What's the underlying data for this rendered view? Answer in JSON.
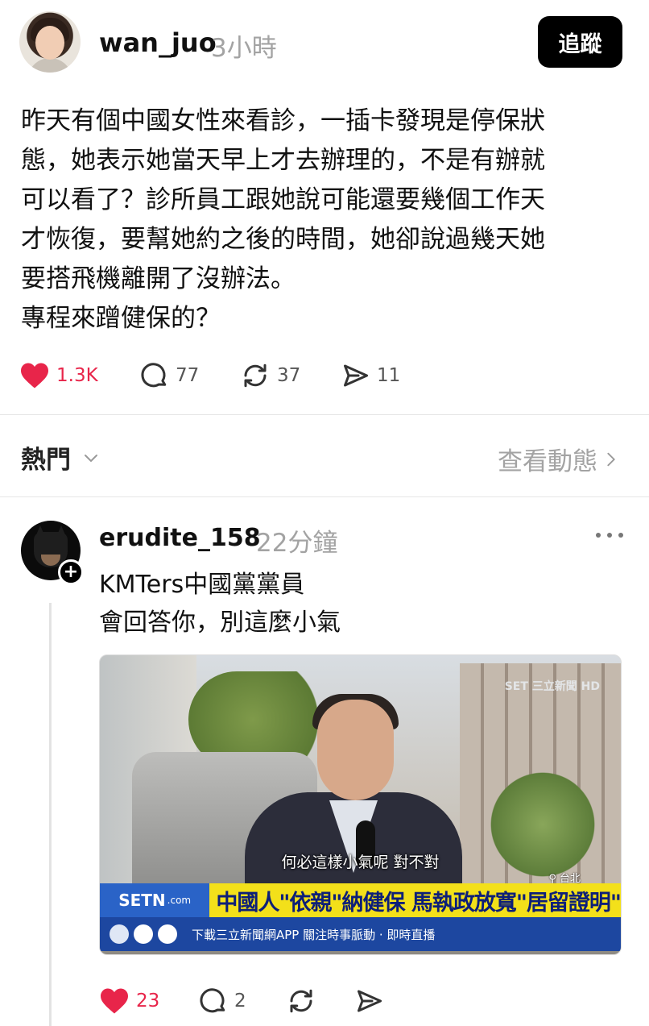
{
  "post": {
    "username": "wan_juo",
    "time": "3小時",
    "follow_label": "追蹤",
    "lines": [
      "昨天有個中國女性來看診，一插卡發現是停保狀",
      "態，她表示她當天早上才去辦理的，不是有辦就",
      "可以看了？診所員工跟她說可能還要幾個工作天",
      "才恢復，要幫她約之後的時間，她卻說過幾天她",
      "要搭飛機離開了沒辦法。",
      "專程來蹭健保的？"
    ],
    "likes": "1.3K",
    "comments": "77",
    "reposts": "37",
    "shares": "11"
  },
  "sort": {
    "label": "熱門",
    "view_activity": "查看動態"
  },
  "reply": {
    "username": "erudite_158",
    "time": "22分鐘",
    "lines": [
      "KMTers中國黨黨員",
      "會回答你，別這麼小氣"
    ],
    "image": {
      "subtitle": "何必這樣小氣呢 對不對",
      "location": "台北",
      "brand": "SETN",
      "brand_suffix": ".com",
      "headline": "中國人\"依親\"納健保 馬執政放寬\"居留證明\"",
      "ticker": "下載三立新聞網APP  關注時事脈動 · 即時直播",
      "corner_logo": "SET 三立新聞 HD"
    },
    "likes": "23",
    "comments": "2"
  },
  "colors": {
    "like_red": "#e8254a",
    "muted": "#a3a3a3",
    "headline_yellow": "#f3e01a",
    "news_blue": "#1e4fa8"
  }
}
